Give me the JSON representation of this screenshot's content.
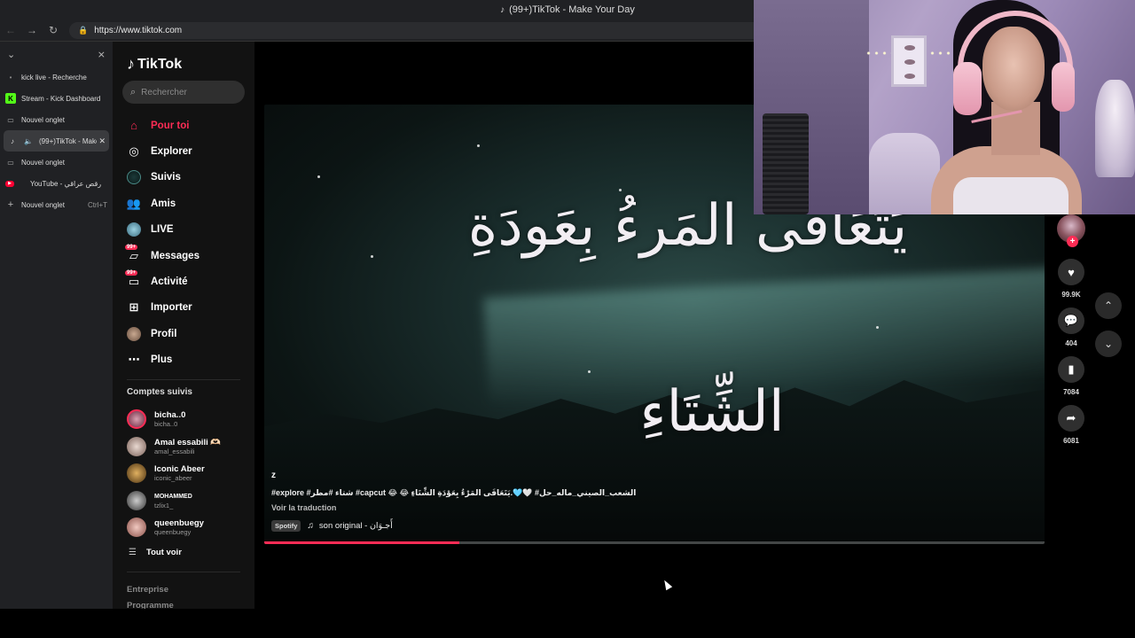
{
  "browser": {
    "window_title": "(99+)TikTok - Make Your Day",
    "url": "https://www.tiktok.com"
  },
  "vertical_tabs": [
    {
      "label": "kick live - Recherche",
      "icon": "dot-icon"
    },
    {
      "label": "Stream - Kick Dashboard",
      "icon": "kick-icon"
    },
    {
      "label": "Nouvel onglet",
      "icon": "tab-icon"
    },
    {
      "label": "(99+)TikTok - Make Your Day",
      "icon": "tiktok-icon",
      "active": true
    },
    {
      "label": "Nouvel onglet",
      "icon": "tab-icon"
    },
    {
      "label": "YouTube - رقص عراقي",
      "icon": "youtube-icon"
    },
    {
      "label": "Nouvel onglet",
      "icon": "plus-icon",
      "shortcut": "Ctrl+T"
    }
  ],
  "tiktok": {
    "logo_text": "TikTok",
    "search_placeholder": "Rechercher",
    "menu": [
      {
        "label": "Pour toi",
        "icon": "home-icon",
        "active": true
      },
      {
        "label": "Explorer",
        "icon": "compass-icon"
      },
      {
        "label": "Suivis",
        "icon": "following-icon"
      },
      {
        "label": "Amis",
        "icon": "friends-icon"
      },
      {
        "label": "LIVE",
        "icon": "live-icon"
      },
      {
        "label": "Messages",
        "icon": "messages-icon",
        "badge": "99+"
      },
      {
        "label": "Activité",
        "icon": "activity-icon",
        "badge": "99+"
      },
      {
        "label": "Importer",
        "icon": "upload-icon"
      },
      {
        "label": "Profil",
        "icon": "profile-icon"
      },
      {
        "label": "Plus",
        "icon": "more-icon"
      }
    ],
    "following_title": "Comptes suivis",
    "following": [
      {
        "name": "bicha..0",
        "username": "bicha..0"
      },
      {
        "name": "Amal essabili 🫶🏻",
        "username": "amal_essabili"
      },
      {
        "name": "Iconic Abeer",
        "username": "iconic_abeer"
      },
      {
        "name": "MOHAMMED",
        "username": "tzlix1_"
      },
      {
        "name": "queenbuegy",
        "username": "queenbuegy"
      }
    ],
    "see_all": "Tout voir",
    "footer": [
      "Entreprise",
      "Programme"
    ]
  },
  "video": {
    "overlay_line1": "يَتَعَافَى المَرءُ بِعَودَةِ",
    "overlay_line2": "الشِّتَاءِ",
    "author": "z",
    "description": "#explore #شتاء #مطر #capcut 😂 😂 الشعب_الصيني_ماله_حل# 🤍🩵.يَتَعَافَى المَرْءُ بِعَوْدَةِ الشِّتَاءِ",
    "translate": "Voir la traduction",
    "spotify_label": "Spotify",
    "sound": "son original - أَجـوَان",
    "progress_fraction": 0.25
  },
  "actions": {
    "likes": "99.9K",
    "comments": "404",
    "saves": "7084",
    "shares": "6081"
  },
  "colors": {
    "accent": "#fe2c55",
    "sidebar_bg": "#121212",
    "chrome_bg": "#202124"
  }
}
